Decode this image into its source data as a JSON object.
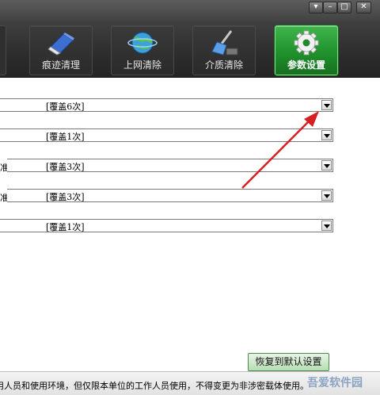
{
  "window_controls": {
    "dropdown": "▾",
    "minimize": "–",
    "maximize": "□",
    "close": "✕"
  },
  "tabs": [
    {
      "label": "痕迹清理",
      "icon": "eraser-icon"
    },
    {
      "label": "上网清除",
      "icon": "globe-icon"
    },
    {
      "label": "介质清除",
      "icon": "broom-icon"
    },
    {
      "label": "参数设置",
      "icon": "gear-icon",
      "active": true
    }
  ],
  "settings": {
    "rows": [
      {
        "label": "",
        "value": "[覆盖6次]"
      },
      {
        "label": "",
        "value": "[覆盖1次]"
      },
      {
        "label": "准",
        "value": "[覆盖3次]"
      },
      {
        "label": "准",
        "value": "[覆盖3次]"
      },
      {
        "label": "",
        "value": "[覆盖1次]"
      }
    ]
  },
  "restore_button": "恢复到默认设置",
  "footer": {
    "notice": "用人员和使用环境，但仅限本单位的工作人员使用，不得变更为非涉密载体使用。"
  },
  "watermark": {
    "text": "吾爱软件园"
  },
  "colors": {
    "active_tab": "#2aa437",
    "annotation_arrow": "#d42020"
  }
}
